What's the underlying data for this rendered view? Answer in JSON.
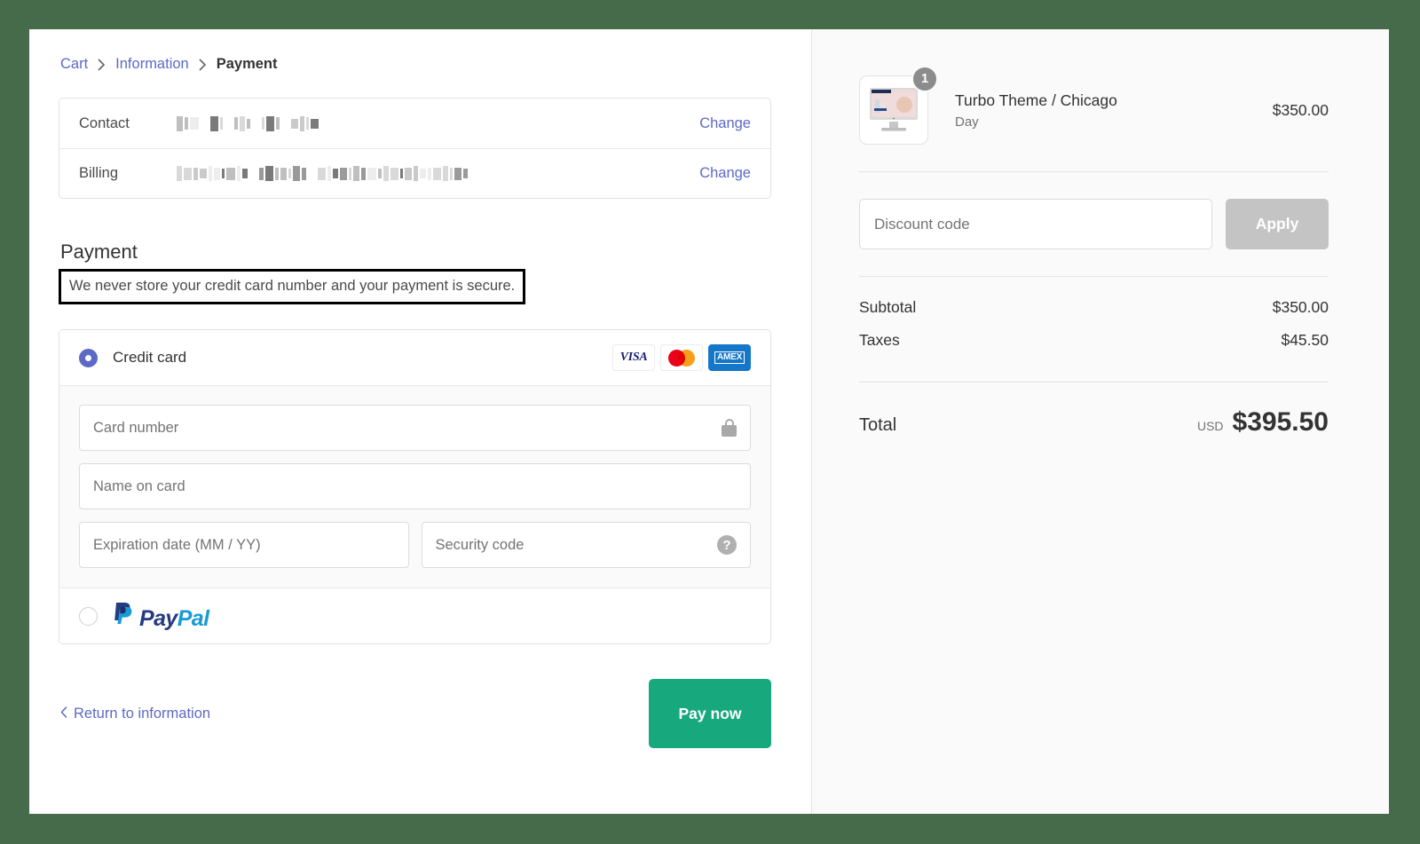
{
  "breadcrumb": {
    "items": [
      {
        "label": "Cart",
        "current": false
      },
      {
        "label": "Information",
        "current": false
      },
      {
        "label": "Payment",
        "current": true
      }
    ]
  },
  "review": {
    "rows": [
      {
        "label": "Contact",
        "value": "",
        "redacted": true,
        "change_label": "Change"
      },
      {
        "label": "Billing",
        "value": "",
        "redacted": true,
        "change_label": "Change"
      }
    ]
  },
  "payment": {
    "heading": "Payment",
    "secure_note": "We never store your credit card number and your payment is secure.",
    "credit_card": {
      "label": "Credit card",
      "selected": true,
      "brands": [
        "VISA",
        "mastercard",
        "AMEX"
      ],
      "amex_text": "AMEX",
      "visa_text": "VISA"
    },
    "fields": {
      "card_number_placeholder": "Card number",
      "name_on_card_placeholder": "Name on card",
      "expiration_placeholder": "Expiration date (MM / YY)",
      "security_code_placeholder": "Security code",
      "lock_icon": "lock-icon",
      "help_icon": "?"
    },
    "paypal": {
      "label_pay": "Pay",
      "label_pal": "Pal",
      "selected": false
    }
  },
  "footer": {
    "return_label": "Return to information",
    "pay_now_label": "Pay now"
  },
  "summary": {
    "item": {
      "title": "Turbo Theme / Chicago",
      "variant": "Day",
      "price": "$350.00",
      "quantity": "1"
    },
    "discount": {
      "placeholder": "Discount code",
      "apply_label": "Apply"
    },
    "lines": [
      {
        "label": "Subtotal",
        "amount": "$350.00"
      },
      {
        "label": "Taxes",
        "amount": "$45.50"
      }
    ],
    "total": {
      "label": "Total",
      "currency": "USD",
      "amount": "$395.50"
    }
  },
  "colors": {
    "page_background": "#466b4a",
    "accent_link": "#5c6ac4",
    "pay_now_button": "#17a97d",
    "apply_disabled": "#c4c4c4",
    "summary_panel": "#fafafa"
  }
}
